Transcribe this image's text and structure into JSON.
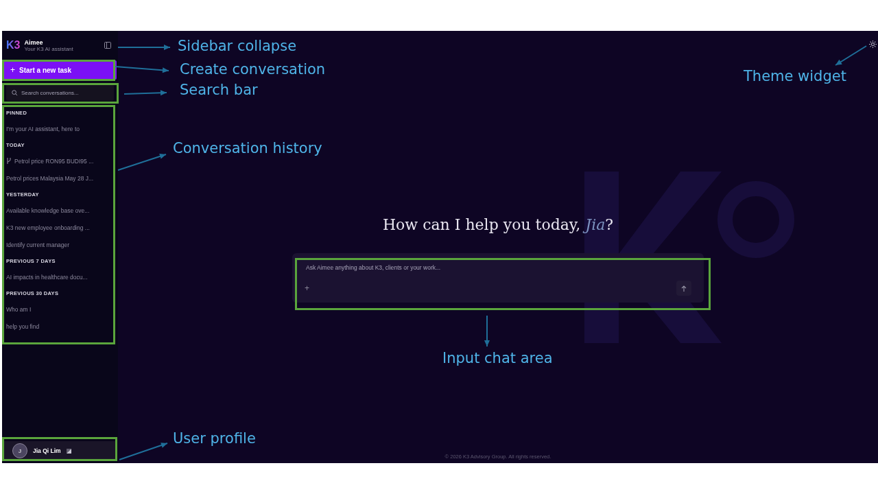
{
  "sidebar": {
    "brand": {
      "logo": "K3",
      "name": "Aimee",
      "subtitle": "Your K3 AI assistant"
    },
    "new_task_button": {
      "icon": "+",
      "label": "Start a new task"
    },
    "search": {
      "placeholder": "Search conversations..."
    },
    "sections": [
      {
        "heading": "PINNED",
        "items": [
          {
            "label": "I'm your AI assistant, here to",
            "kind": "plain"
          }
        ]
      },
      {
        "heading": "TODAY",
        "items": [
          {
            "label": "Petrol price RON95 BUDI95 ...",
            "kind": "branch"
          },
          {
            "label": "Petrol prices Malaysia May 28 J...",
            "kind": "plain"
          }
        ]
      },
      {
        "heading": "YESTERDAY",
        "items": [
          {
            "label": "Available knowledge base ove...",
            "kind": "plain"
          },
          {
            "label": "K3 new employee onboarding ...",
            "kind": "plain"
          },
          {
            "label": "Identify current manager",
            "kind": "plain"
          }
        ]
      },
      {
        "heading": "PREVIOUS 7 DAYS",
        "items": [
          {
            "label": "AI impacts in healthcare docu...",
            "kind": "plain"
          }
        ]
      },
      {
        "heading": "PREVIOUS 30 DAYS",
        "items": [
          {
            "label": "Who am I",
            "kind": "plain"
          },
          {
            "label": "help you find",
            "kind": "plain"
          }
        ]
      }
    ],
    "user": {
      "initial": "J",
      "name": "Jia Qi Lim"
    }
  },
  "main": {
    "greeting": "How can I help you today, *Jia*?",
    "input": {
      "placeholder": "Ask Aimee anything about K3, clients or your work...",
      "add_icon": "+"
    },
    "footer": "© 2026 K3 Advisory Group. All rights reserved."
  },
  "annotations": [
    {
      "label": "Sidebar collapse"
    },
    {
      "label": "Create conversation"
    },
    {
      "label": "Search bar"
    },
    {
      "label": "Conversation history"
    },
    {
      "label": "Theme widget"
    },
    {
      "label": "Input chat area"
    },
    {
      "label": "User profile"
    }
  ]
}
